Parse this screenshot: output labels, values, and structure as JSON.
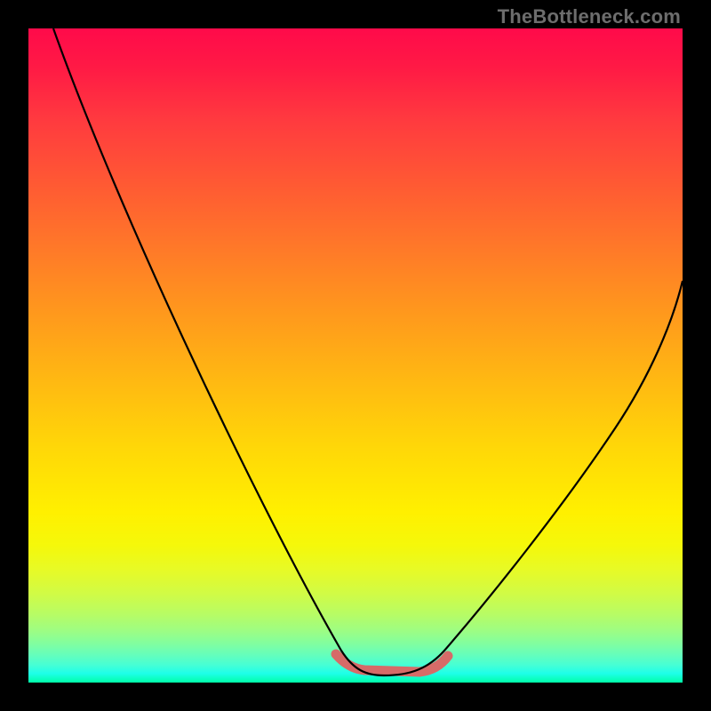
{
  "watermark": "TheBottleneck.com",
  "colors": {
    "frame": "#000000",
    "curve": "#000000",
    "plateau": "#d66b68"
  },
  "chart_data": {
    "type": "line",
    "title": "",
    "xlabel": "",
    "ylabel": "",
    "xlim": [
      0,
      100
    ],
    "ylim": [
      0,
      100
    ],
    "grid": false,
    "series": [
      {
        "name": "bottleneck-curve",
        "x": [
          4,
          10,
          16,
          22,
          28,
          34,
          40,
          45,
          49,
          52,
          55,
          58,
          62,
          66,
          71,
          77,
          84,
          92,
          100
        ],
        "y": [
          100,
          88,
          76,
          64,
          52,
          40,
          28,
          16,
          6,
          1,
          0,
          1,
          6,
          14,
          24,
          34,
          44,
          54,
          62
        ]
      }
    ],
    "annotations": [
      {
        "name": "plateau-highlight",
        "x_range": [
          48,
          62
        ],
        "y": 1
      }
    ],
    "gradient_stops": [
      {
        "pos": 0.0,
        "color": "#ff0a4a"
      },
      {
        "pos": 0.5,
        "color": "#ffb912"
      },
      {
        "pos": 0.74,
        "color": "#fff000"
      },
      {
        "pos": 1.0,
        "color": "#00ffa8"
      }
    ]
  }
}
